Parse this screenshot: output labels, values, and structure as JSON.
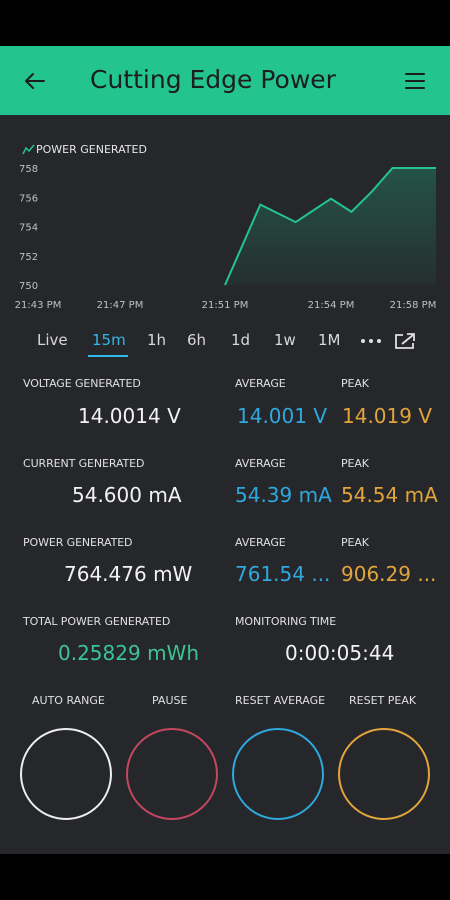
{
  "app": {
    "title": "Cutting Edge Power"
  },
  "chart": {
    "label": "POWER GENERATED",
    "y_ticks": [
      "758",
      "756",
      "754",
      "752",
      "750"
    ],
    "x_ticks": [
      "21:43 PM",
      "21:47 PM",
      "21:51 PM",
      "21:54 PM",
      "21:58 PM"
    ]
  },
  "chart_data": {
    "type": "area",
    "title": "POWER GENERATED",
    "xlabel": "",
    "ylabel": "",
    "ylim": [
      750,
      758
    ],
    "x": [
      "21:51 PM",
      "21:52 PM",
      "21:53 PM",
      "21:54 PM",
      "21:55 PM",
      "21:56 PM",
      "21:57 PM",
      "21:58 PM"
    ],
    "values": [
      750.0,
      755.5,
      754.3,
      755.9,
      755.0,
      756.4,
      758.0,
      758.0
    ],
    "colors": {
      "line": "#23c48e",
      "fill": "#23c48e"
    }
  },
  "tabs": [
    "Live",
    "15m",
    "1h",
    "6h",
    "1d",
    "1w",
    "1M"
  ],
  "active_tab": "15m",
  "metrics": {
    "voltage": {
      "label": "VOLTAGE GENERATED",
      "value": "14.0014 V",
      "avg_label": "AVERAGE",
      "avg": "14.001 V",
      "peak_label": "PEAK",
      "peak": "14.019 V"
    },
    "current": {
      "label": "CURRENT GENERATED",
      "value": "54.600 mA",
      "avg_label": "AVERAGE",
      "avg": "54.39 mA",
      "peak_label": "PEAK",
      "peak": "54.54 mA"
    },
    "power": {
      "label": "POWER GENERATED",
      "value": "764.476 mW",
      "avg_label": "AVERAGE",
      "avg": "761.54 ...",
      "peak_label": "PEAK",
      "peak": "906.29 ..."
    },
    "total": {
      "label": "TOTAL POWER GENERATED",
      "value": "0.25829 mWh"
    },
    "time": {
      "label": "MONITORING TIME",
      "value": "0:00:05:44"
    }
  },
  "buttons": {
    "auto_range": "AUTO RANGE",
    "pause": "PAUSE",
    "reset_average": "RESET AVERAGE",
    "reset_peak": "RESET PEAK"
  },
  "colors": {
    "accent": "#23c48e",
    "background": "#25272b",
    "blue": "#2fa8de",
    "orange": "#e2a43b",
    "pink": "#c2475f",
    "white": "#f2f2f2"
  }
}
